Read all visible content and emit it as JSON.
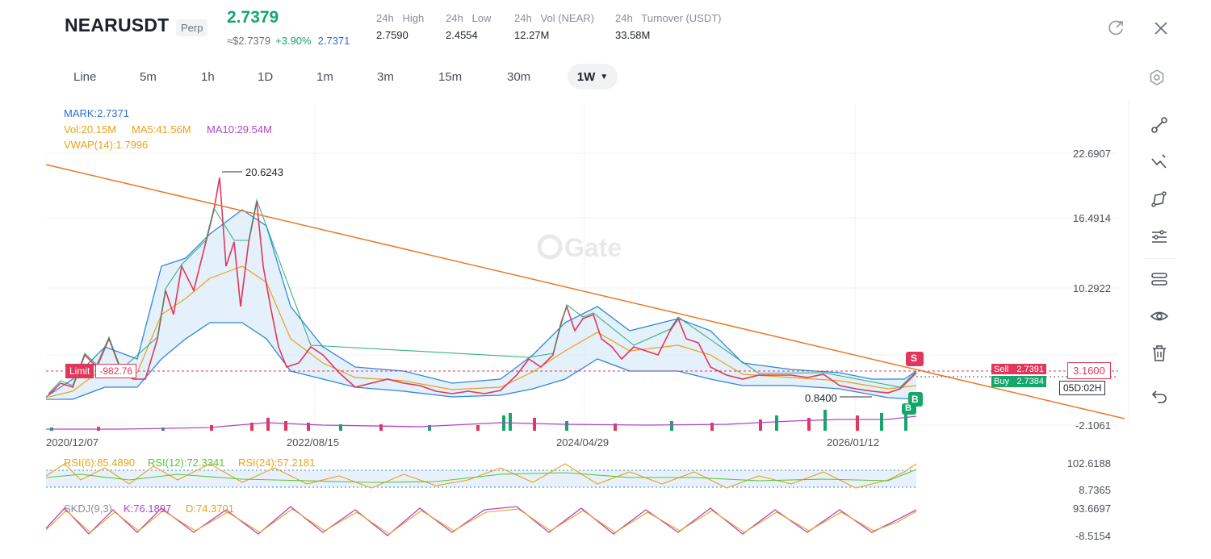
{
  "header": {
    "symbol": "NEARUSDT",
    "badge": "Perp",
    "last_price": "2.7379",
    "usd_price": "≈$2.7379",
    "change_pct": "+3.90%",
    "mark_price": "2.7371",
    "stats": [
      {
        "label": "24h   High",
        "value": "2.7590"
      },
      {
        "label": "24h   Low",
        "value": "2.4554"
      },
      {
        "label": "24h   Vol (NEAR)",
        "value": "12.27M"
      },
      {
        "label": "24h   Turnover (USDT)",
        "value": "33.58M"
      }
    ]
  },
  "timeframes": [
    "Line",
    "5m",
    "1h",
    "1D",
    "1m",
    "3m",
    "15m",
    "30m"
  ],
  "active_timeframe": "1W",
  "indicators": {
    "mark": "MARK:2.7371",
    "vol": "Vol:20.15M",
    "ma5": "MA5:41.56M",
    "ma10": "MA10:29.54M",
    "vwap": "VWAP(14):1.7996",
    "rsi6": "RSI(6):85.4890",
    "rsi12": "RSI(12):72.3341",
    "rsi24": "RSI(24):57.2181",
    "skdj": "SKDJ(9,3)",
    "k": "K:76.1897",
    "d": "D:74.3701"
  },
  "y_axis": [
    "22.6907",
    "16.4914",
    "10.2922",
    "-2.1061"
  ],
  "rsi_axis": [
    "102.6188",
    "8.7365"
  ],
  "kdj_axis": [
    "93.6697",
    "-8.5154"
  ],
  "x_axis": [
    "2020/12/07",
    "2022/08/15",
    "2024/04/29",
    "2026/01/12"
  ],
  "chart_labels": {
    "high_marker": "20.6243",
    "low_marker": "0.8400",
    "limit_label": "Limit",
    "limit_value": "-982.76",
    "sell_label": "Sell",
    "sell_price": "2.7391",
    "buy_label": "Buy",
    "buy_price": "2.7384",
    "current_price_box": "3.1600",
    "countdown": "05D:02H",
    "sell_marker": "S",
    "buy_marker": "B",
    "buy_marker2": "B"
  },
  "colors": {
    "up": "#15a66c",
    "down": "#e2365b",
    "trendline": "#e8782a",
    "band": "#2e86de",
    "mark_text": "#2a6fd6",
    "ma5": "#e8a21a",
    "ma10": "#b145c7",
    "rsi12": "#5cc23a"
  },
  "chart_data": {
    "type": "candlestick",
    "x": [
      "2020/12/07",
      "2022/08/15",
      "2024/04/29",
      "2026/01/12"
    ],
    "ylim": [
      -2.1061,
      22.6907
    ],
    "annotated_high": 20.6243,
    "annotated_low": 0.84,
    "last_price": 2.7379
  }
}
